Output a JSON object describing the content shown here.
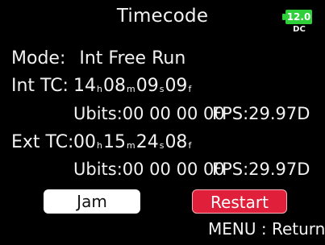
{
  "header": {
    "title": "Timecode",
    "battery_level": "12.0",
    "power_source": "DC",
    "battery_color": "#2fcf3a"
  },
  "mode": {
    "label": "Mode:",
    "value": "Int Free Run"
  },
  "int_tc": {
    "label": "Int TC:",
    "hours": "14",
    "minutes": "08",
    "seconds": "09",
    "frames": "09",
    "ubits": "Ubits:00 00 00 00",
    "fps": "FPS:29.97D"
  },
  "ext_tc": {
    "label": "Ext TC:",
    "hours": "00",
    "minutes": "15",
    "seconds": "24",
    "frames": "08",
    "ubits": "Ubits:00 00 00 00",
    "fps": "FPS:29.97D"
  },
  "units": {
    "hours": "h",
    "minutes": "m",
    "seconds": "s",
    "frames": "f"
  },
  "buttons": {
    "jam_label": "Jam",
    "restart_label": "Restart",
    "restart_color": "#e0203a"
  },
  "footer": {
    "menu_hint": "MENU : Return"
  }
}
